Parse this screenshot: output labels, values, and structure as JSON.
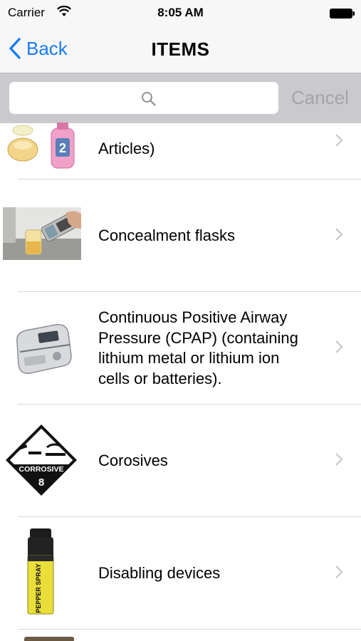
{
  "status_bar": {
    "carrier": "Carrier",
    "time": "8:05 AM"
  },
  "nav": {
    "back_label": "Back",
    "title": "ITEMS"
  },
  "search": {
    "placeholder": "",
    "cancel_label": "Cancel"
  },
  "items": [
    {
      "label": "Articles)",
      "image": "perfume-bottles-image"
    },
    {
      "label": "Concealment flasks",
      "image": "flask-phone-image"
    },
    {
      "label": "Continuous Positive Airway Pressure (CPAP) (containing lithium metal or lithium ion cells or batteries).",
      "image": "cpap-machine-image"
    },
    {
      "label": "Corosives",
      "image": "corrosive-sign-image",
      "sign_text": "CORROSIVE",
      "sign_number": "8"
    },
    {
      "label": "Disabling devices",
      "image": "pepper-spray-image",
      "can_text": "PEPPER SPRAY"
    }
  ],
  "colors": {
    "accent": "#1a7cf5",
    "separator": "#d9d9dc",
    "search_bar_bg": "#c9c9ce"
  }
}
